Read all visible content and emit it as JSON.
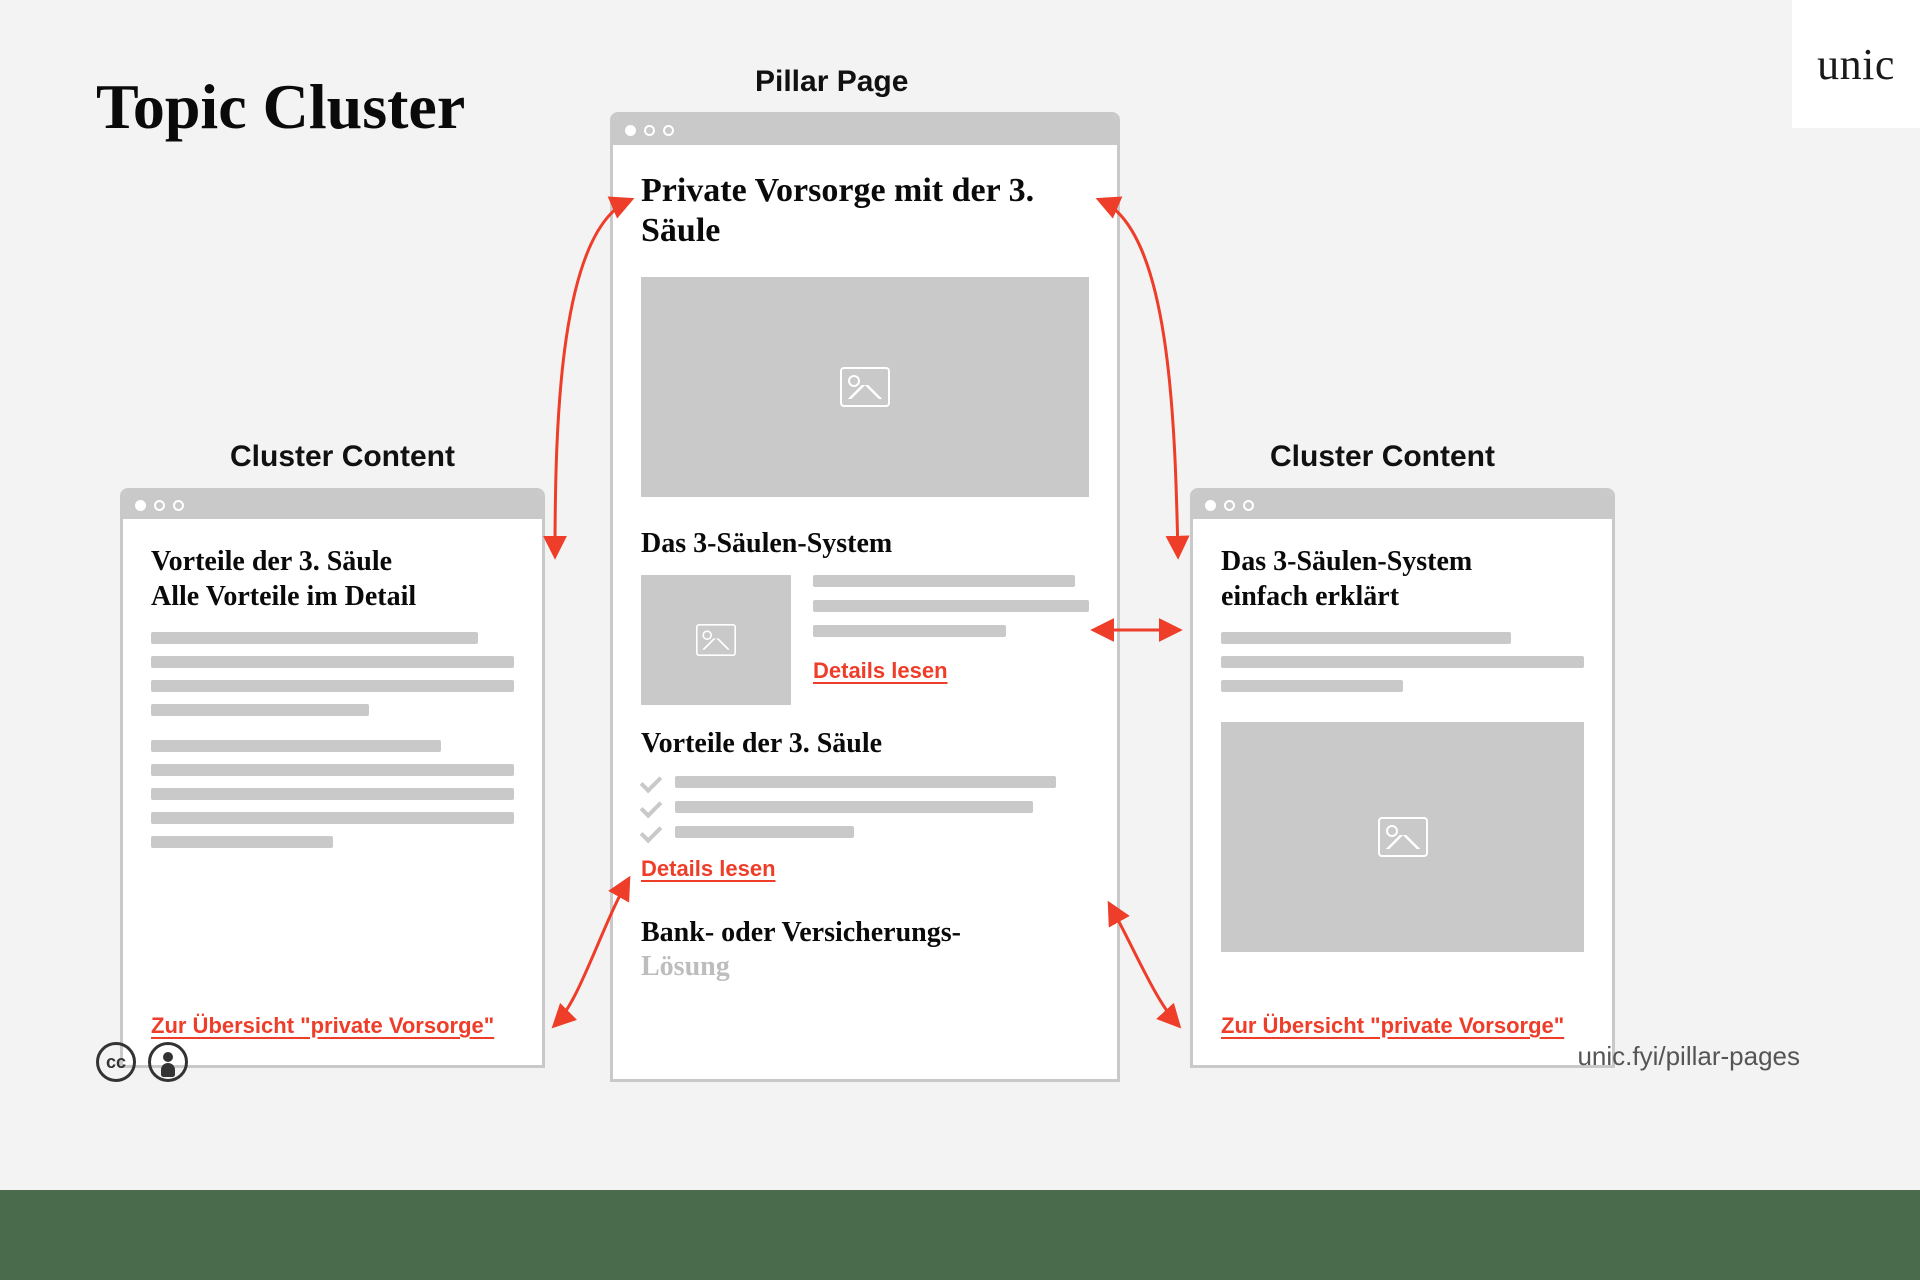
{
  "header": {
    "title": "Topic Cluster",
    "logo": "unic"
  },
  "labels": {
    "left": "Cluster Content",
    "center": "Pillar Page",
    "right": "Cluster Content"
  },
  "pillar": {
    "title": "Private Vorsorge mit der 3. Säule",
    "section1": {
      "heading": "Das 3-Säulen-System",
      "link": "Details lesen"
    },
    "section2": {
      "heading": "Vorteile der 3. Säule",
      "link": "Details lesen"
    },
    "section3_line1": "Bank- oder Versicherungs-",
    "section3_line2": "Lösung"
  },
  "cluster_left": {
    "title_line1": "Vorteile der 3. Säule",
    "title_line2": "Alle Vorteile im Detail",
    "link": "Zur Übersicht \"private Vorsorge\""
  },
  "cluster_right": {
    "title_line1": "Das 3-Säulen-System",
    "title_line2": "einfach erklärt",
    "link": "Zur Übersicht \"private Vorsorge\""
  },
  "footer": {
    "url": "unic.fyi/pillar-pages"
  },
  "colors": {
    "accent": "#ee3d29",
    "grey": "#c9c9c9",
    "bg": "#f3f3f3",
    "green": "#4a6b4c"
  }
}
